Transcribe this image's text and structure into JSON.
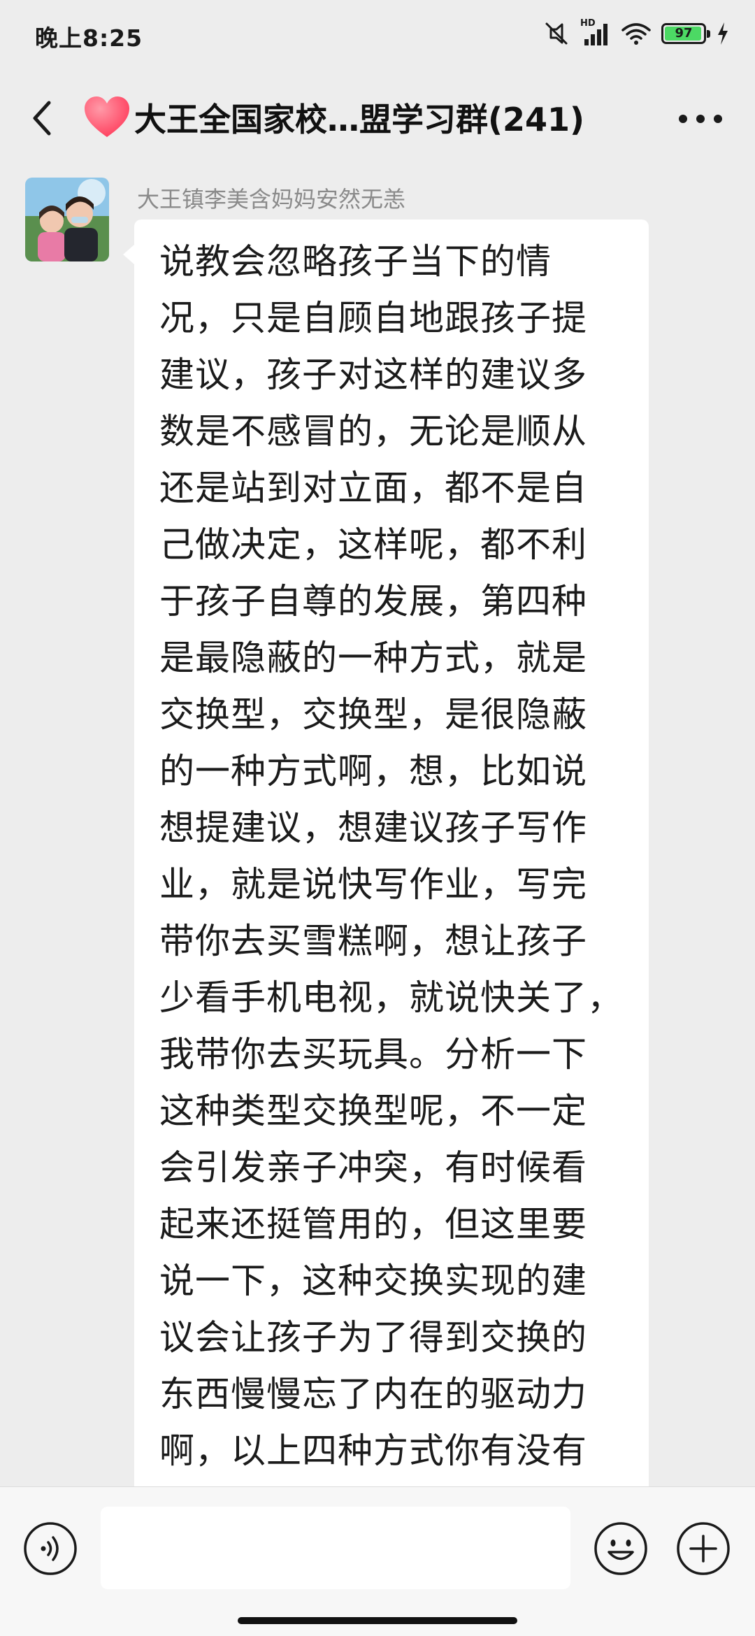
{
  "status_bar": {
    "time": "晚上8:25",
    "network_label": "HD",
    "battery_level": "97",
    "battery_fraction": 0.97,
    "icons": [
      "mute-icon",
      "signal-icon",
      "wifi-icon",
      "battery-icon",
      "charging-icon"
    ]
  },
  "header": {
    "back_icon": "chevron-left-icon",
    "title": "大王全国家校…盟学习群(241)",
    "title_icon": "heart-icon",
    "heart_color": "#ff4d6a",
    "more_icon": "more-dots-icon"
  },
  "messages": [
    {
      "sender": "大王镇李美含妈妈安然无恙",
      "text": "说教会忽略孩子当下的情\n况，只是自顾自地跟孩子提\n建议，孩子对这样的建议多\n数是不感冒的，无论是顺从\n还是站到对立面，都不是自\n己做决定，这样呢，都不利\n于孩子自尊的发展，第四种\n是最隐蔽的一种方式，就是\n交换型，交换型，是很隐蔽\n的一种方式啊，想，比如说\n想提建议，想建议孩子写作\n业，就是说快写作业，写完\n带你去买雪糕啊，想让孩子\n少看手机电视，就说快关了，\n我带你去买玩具。分析一下\n这种类型交换型呢，不一定\n会引发亲子冲突，有时候看\n起来还挺管用的，但这里要\n说一下，这种交换实现的建\n议会让孩子为了得到交换的\n东西慢慢忘了内在的驱动力\n啊，以上四种方式你有没有"
    }
  ],
  "input_bar": {
    "voice_icon": "voice-icon",
    "input_value": "",
    "emoji_icon": "emoji-icon",
    "plus_icon": "plus-icon"
  }
}
